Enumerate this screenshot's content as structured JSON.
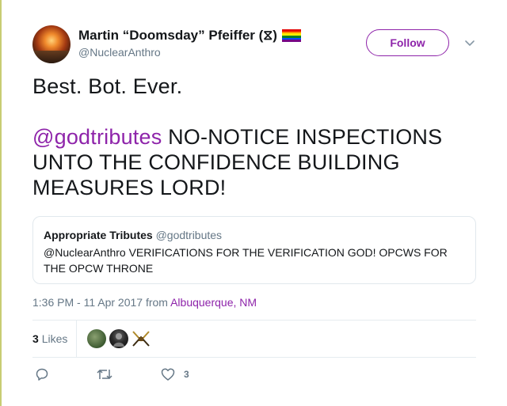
{
  "author": {
    "display_name": "Martin “Doomsday” Pfeiffer (⧖)",
    "handle": "@NuclearAnthro",
    "flag": "rainbow-flag-icon"
  },
  "follow_label": "Follow",
  "tweet": {
    "line1": "Best. Bot. Ever.",
    "mention": "@godtributes",
    "body": " NO-NOTICE INSPECTIONS UNTO THE CONFIDENCE BUILDING MEASURES LORD!"
  },
  "quote": {
    "name": "Appropriate Tributes",
    "handle": "@godtributes",
    "text": "@NuclearAnthro VERIFICATIONS FOR THE VERIFICATION GOD! OPCWS FOR THE OPCW THRONE"
  },
  "meta": {
    "timestamp": "1:36 PM - 11 Apr 2017",
    "from_label": "from",
    "place": "Albuquerque, NM"
  },
  "likes": {
    "count": "3",
    "label": "Likes"
  },
  "actions": {
    "like_count": "3"
  },
  "colors": {
    "accent": "#8e24aa",
    "secondary_text": "#657786",
    "primary_text": "#14171a",
    "border": "#e1e8ed"
  }
}
